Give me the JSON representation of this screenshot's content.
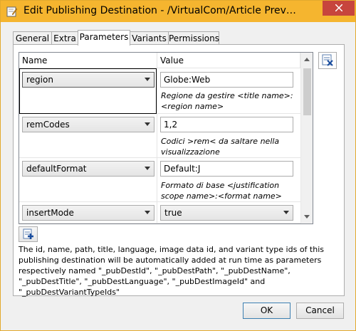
{
  "window": {
    "title": "Edit Publishing Destination - /VirtualCom/Article Prev…",
    "close_glyph": "✕"
  },
  "tabs": [
    {
      "label": "General"
    },
    {
      "label": "Extra"
    },
    {
      "label": "Parameters",
      "active": true
    },
    {
      "label": "Variants"
    },
    {
      "label": "Permissions"
    }
  ],
  "grid": {
    "headers": {
      "name": "Name",
      "value": "Value"
    },
    "rows": [
      {
        "name": "region",
        "value": "Globe:Web",
        "value_type": "text",
        "description": "Regione da gestire <title name>:<region name>"
      },
      {
        "name": "remCodes",
        "value": "1,2",
        "value_type": "text",
        "description": "Codici >rem< da saltare nella visualizzazione"
      },
      {
        "name": "defaultFormat",
        "value": "Default:J",
        "value_type": "text",
        "description": "Formato di base <justification scope name>:<format name>"
      },
      {
        "name": "insertMode",
        "value": "true",
        "value_type": "select",
        "description": ""
      }
    ]
  },
  "info_text": "The id, name, path, title, language, image data id, and variant type ids of this publishing destination will be automatically added at run time as parameters respectively named \"_pubDestId\", \"_pubDestPath\", \"_pubDestName\", \"_pubDestTitle\", \"_pubDestLanguage\", \"_pubDestImageId\" and \"_pubDestVariantTypeIds\"",
  "buttons": {
    "ok_label": "OK",
    "cancel_label": "Cancel"
  },
  "colors": {
    "titlebar": "#f5b52f",
    "close": "#c7453d",
    "accent": "#3c7fb1"
  }
}
